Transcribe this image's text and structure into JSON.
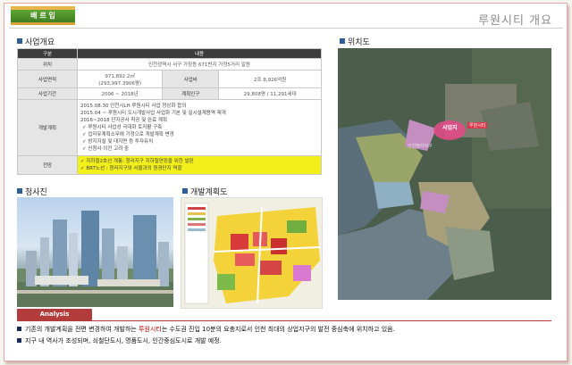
{
  "header": {
    "badge": "배 르 입",
    "title": "루원시티 개요"
  },
  "sections": {
    "overview": "사업개요",
    "location": "위치도",
    "photo": "청사진",
    "plan": "개발계획도"
  },
  "table": {
    "headers": [
      "구분",
      "내용"
    ],
    "rows": [
      {
        "label": "위치",
        "value": "인천광역시 서구 가정동 671번지 가정5거리 일원"
      },
      {
        "label": "사업면적",
        "value": "971,892.2㎡",
        "value2": "(293,997.3906평)",
        "label2": "사업비",
        "value3": "2조 8,926억원"
      },
      {
        "label": "사업기간",
        "value": "2006 ~ 2018년",
        "label2": "계획인구",
        "value3": "29,808명 / 11,291세대"
      }
    ],
    "plan_label": "개발계획",
    "plan_lines": [
      "2015.08.30 인천시LH 루원시티 사업 정상화 합의",
      "2015.04 ~ 루원시티 도시개발사업 사업화 기본 및 실시설계용역 재개",
      "2016~2018 단지공사 착공 및 완료 계획"
    ],
    "plan_bullets": [
      "루원시티 사업성 극대화 토지활 구축",
      "업자유계획소무에 기정으로 개발계획 변경",
      "방지지설 및 대지면 등 투자유치",
      "신청사 이전 고려 중"
    ],
    "outlook_label": "전망",
    "outlook_lines": [
      "지하철2호선 개통: 청라지구 지하철연장을 위한 발판",
      "BRT노선 : 청라지구와 서울과의 원경단지 역할"
    ]
  },
  "map_labels": {
    "site": "사업지",
    "site2": "루원시티",
    "district": "인천청라지구"
  },
  "analysis": {
    "tag": "Analysis",
    "line1_a": "기존의 개발계획을 전면 변경하여 개발하는 ",
    "line1_em": "루원시티",
    "line1_b": "는 수도권 진입 10분의 요충지로서 인천 최대의 상업지구의 발전 중심축에 위치하고 있음.",
    "line2": "지구 내 역사가 조성되며, 쇠철단도시, 명품도시, 인간중심도시로 개발 예정."
  },
  "colors": {
    "badge_green": "#4a8f27",
    "badge_gold": "#e9b64a",
    "section_square": "#2e5f96",
    "table_header": "#3c3c3c",
    "outlook_yellow": "#f2ef1a",
    "analysis_red": "#b23b3b"
  }
}
